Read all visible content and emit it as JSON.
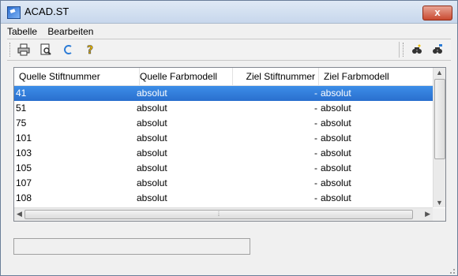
{
  "window": {
    "title": "ACAD.ST",
    "close_label": "x"
  },
  "menu": [
    {
      "label": "Tabelle"
    },
    {
      "label": "Bearbeiten"
    }
  ],
  "toolbar": {
    "left_icons": [
      "printer-icon",
      "print-preview-icon",
      "refresh-icon",
      "help-icon"
    ],
    "right_icons": [
      "find-icon",
      "find-replace-icon"
    ]
  },
  "table": {
    "columns": [
      "Quelle Stiftnummer",
      "Quelle Farbmodell",
      "Ziel Stiftnummer",
      "Ziel Farbmodell"
    ],
    "rows": [
      {
        "src_pen": "41",
        "src_model": "absolut",
        "dst_pen": "-",
        "dst_model": "absolut"
      },
      {
        "src_pen": "51",
        "src_model": "absolut",
        "dst_pen": "-",
        "dst_model": "absolut"
      },
      {
        "src_pen": "75",
        "src_model": "absolut",
        "dst_pen": "-",
        "dst_model": "absolut"
      },
      {
        "src_pen": "101",
        "src_model": "absolut",
        "dst_pen": "-",
        "dst_model": "absolut"
      },
      {
        "src_pen": "103",
        "src_model": "absolut",
        "dst_pen": "-",
        "dst_model": "absolut"
      },
      {
        "src_pen": "105",
        "src_model": "absolut",
        "dst_pen": "-",
        "dst_model": "absolut"
      },
      {
        "src_pen": "107",
        "src_model": "absolut",
        "dst_pen": "-",
        "dst_model": "absolut"
      },
      {
        "src_pen": "108",
        "src_model": "absolut",
        "dst_pen": "-",
        "dst_model": "absolut"
      }
    ],
    "selected_index": 0
  },
  "colors": {
    "selection": "#3d8ee8",
    "close": "#c94a30"
  }
}
